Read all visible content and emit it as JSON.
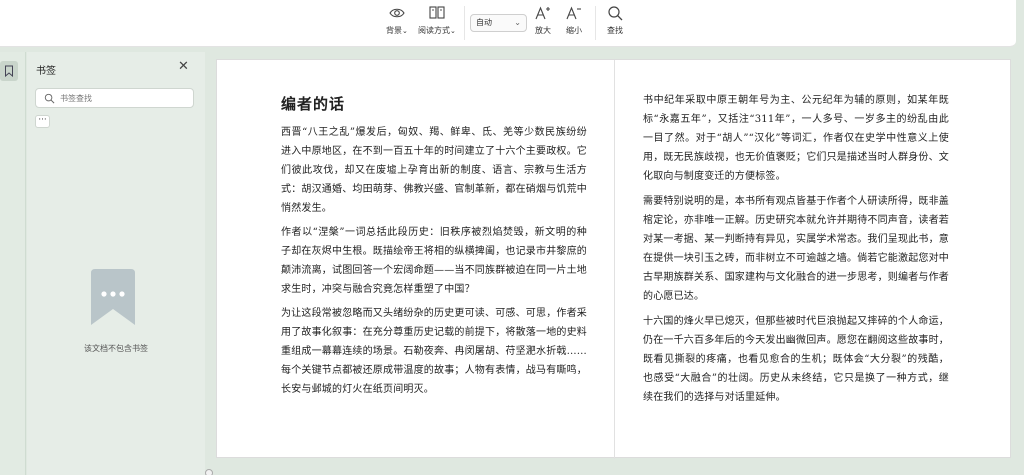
{
  "toolbar": {
    "background_label": "背景",
    "reading_mode_label": "阅读方式",
    "zoom_value": "自动",
    "zoom_in_label": "放大",
    "zoom_out_label": "缩小",
    "search_label": "查找",
    "chevron_glyph": "⌄"
  },
  "panel": {
    "title": "书签",
    "close_glyph": "✕",
    "search_placeholder": "书签查找",
    "more_glyph": "···",
    "empty_text": "该文档不包含书签"
  },
  "document": {
    "title": "编者的话",
    "left_paragraphs": [
      "西晋“八王之乱”爆发后，匈奴、羯、鲜卑、氐、羌等少数民族纷纷进入中原地区，在不到一百五十年的时间建立了十六个主要政权。它们彼此攻伐，却又在废墟上孕育出新的制度、语言、宗教与生活方式：胡汉通婚、均田萌芽、佛教兴盛、官制革新，都在硝烟与饥荒中悄然发生。",
      "作者以“涅槃”一词总括此段历史：旧秩序被烈焰焚毁，新文明的种子却在灰烬中生根。既描绘帝王将相的纵横捭阖，也记录市井黎庶的颠沛流离，试图回答一个宏阔命题——当不同族群被迫在同一片土地求生时，冲突与融合究竟怎样重塑了中国？",
      "为让这段常被忽略而又头绪纷杂的历史更可读、可感、可思，作者采用了故事化叙事：在充分尊重历史记载的前提下，将散落一地的史料重组成一幕幕连续的场景。石勒夜奔、冉闵屠胡、苻坚淝水折戟……每个关键节点都被还原成带温度的故事；人物有表情，战马有嘶鸣，长安与邺城的灯火在纸页间明灭。"
    ],
    "right_paragraphs": [
      "书中纪年采取中原王朝年号为主、公元纪年为辅的原则，如某年既标“永嘉五年”，又括注“311年”，一人多号、一岁多主的纷乱由此一目了然。对于“胡人”“汉化”等词汇，作者仅在史学中性意义上使用，既无民族歧视，也无价值褒贬；它们只是描述当时人群身份、文化取向与制度变迁的方便标签。",
      "需要特别说明的是，本书所有观点皆基于作者个人研读所得，既非盖棺定论，亦非唯一正解。历史研究本就允许并期待不同声音，读者若对某一考据、某一判断持有异见，实属学术常态。我们呈现此书，意在提供一块引玉之砖，而非树立不可逾越之墙。倘若它能激起您对中古早期族群关系、国家建构与文化融合的进一步思考，则编者与作者的心愿已达。",
      "十六国的烽火早已熄灭，但那些被时代巨浪抛起又摔碎的个人命运，仍在一千六百多年后的今天发出幽微回声。愿您在翻阅这些故事时，既看见撕裂的疼痛，也看见愈合的生机；既体会“大分裂”的残酷，也感受“大融合”的壮阔。历史从未终结，它只是换了一种方式，继续在我们的选择与对话里延伸。"
    ]
  }
}
